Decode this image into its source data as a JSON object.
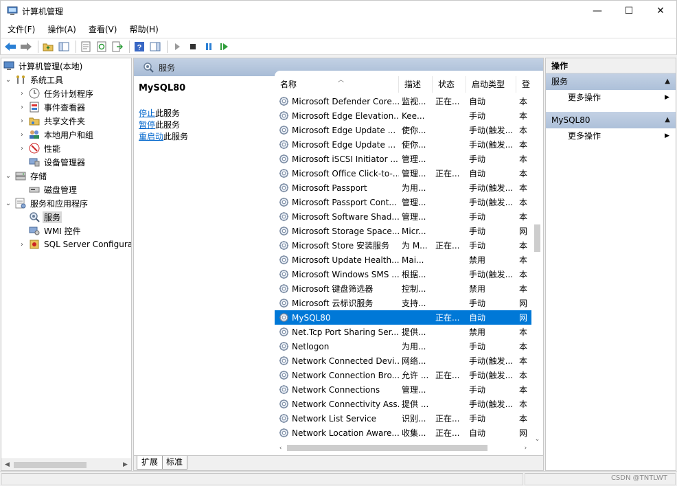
{
  "window": {
    "title": "计算机管理",
    "minimize": "—",
    "maximize": "☐",
    "close": "✕"
  },
  "menu": [
    "文件(F)",
    "操作(A)",
    "查看(V)",
    "帮助(H)"
  ],
  "tree": {
    "root": "计算机管理(本地)",
    "items": [
      {
        "label": "系统工具",
        "level": 1,
        "expanded": true
      },
      {
        "label": "任务计划程序",
        "level": 2
      },
      {
        "label": "事件查看器",
        "level": 2
      },
      {
        "label": "共享文件夹",
        "level": 2
      },
      {
        "label": "本地用户和组",
        "level": 2
      },
      {
        "label": "性能",
        "level": 2
      },
      {
        "label": "设备管理器",
        "level": 2
      },
      {
        "label": "存储",
        "level": 1,
        "expanded": true
      },
      {
        "label": "磁盘管理",
        "level": 2
      },
      {
        "label": "服务和应用程序",
        "level": 1,
        "expanded": true
      },
      {
        "label": "服务",
        "level": 2,
        "selected": true
      },
      {
        "label": "WMI 控件",
        "level": 2
      },
      {
        "label": "SQL Server Configura",
        "level": 2
      }
    ]
  },
  "center": {
    "header": "服务",
    "selected_service": "MySQL80",
    "links": [
      {
        "link": "停止",
        "rest": "此服务"
      },
      {
        "link": "暂停",
        "rest": "此服务"
      },
      {
        "link": "重启动",
        "rest": "此服务"
      }
    ],
    "columns": [
      "名称",
      "描述",
      "状态",
      "启动类型",
      "登"
    ],
    "rows": [
      {
        "name": "Microsoft Defender Core...",
        "desc": "监视...",
        "status": "正在...",
        "startup": "自动",
        "logon": "本"
      },
      {
        "name": "Microsoft Edge Elevation...",
        "desc": "Kee...",
        "status": "",
        "startup": "手动",
        "logon": "本"
      },
      {
        "name": "Microsoft Edge Update ...",
        "desc": "使你...",
        "status": "",
        "startup": "手动(触发...",
        "logon": "本"
      },
      {
        "name": "Microsoft Edge Update ...",
        "desc": "使你...",
        "status": "",
        "startup": "手动(触发...",
        "logon": "本"
      },
      {
        "name": "Microsoft iSCSI Initiator ...",
        "desc": "管理...",
        "status": "",
        "startup": "手动",
        "logon": "本"
      },
      {
        "name": "Microsoft Office Click-to-...",
        "desc": "管理...",
        "status": "正在...",
        "startup": "自动",
        "logon": "本"
      },
      {
        "name": "Microsoft Passport",
        "desc": "为用...",
        "status": "",
        "startup": "手动(触发...",
        "logon": "本"
      },
      {
        "name": "Microsoft Passport Cont...",
        "desc": "管理...",
        "status": "",
        "startup": "手动(触发...",
        "logon": "本"
      },
      {
        "name": "Microsoft Software Shad...",
        "desc": "管理...",
        "status": "",
        "startup": "手动",
        "logon": "本"
      },
      {
        "name": "Microsoft Storage Space...",
        "desc": "Micr...",
        "status": "",
        "startup": "手动",
        "logon": "网"
      },
      {
        "name": "Microsoft Store 安装服务",
        "desc": "为 M...",
        "status": "正在...",
        "startup": "手动",
        "logon": "本"
      },
      {
        "name": "Microsoft Update Health...",
        "desc": "Mai...",
        "status": "",
        "startup": "禁用",
        "logon": "本"
      },
      {
        "name": "Microsoft Windows SMS ...",
        "desc": "根据...",
        "status": "",
        "startup": "手动(触发...",
        "logon": "本"
      },
      {
        "name": "Microsoft 键盘筛选器",
        "desc": "控制...",
        "status": "",
        "startup": "禁用",
        "logon": "本"
      },
      {
        "name": "Microsoft 云标识服务",
        "desc": "支持...",
        "status": "",
        "startup": "手动",
        "logon": "网"
      },
      {
        "name": "MySQL80",
        "desc": "",
        "status": "正在...",
        "startup": "自动",
        "logon": "网",
        "selected": true
      },
      {
        "name": "Net.Tcp Port Sharing Ser...",
        "desc": "提供...",
        "status": "",
        "startup": "禁用",
        "logon": "本"
      },
      {
        "name": "Netlogon",
        "desc": "为用...",
        "status": "",
        "startup": "手动",
        "logon": "本"
      },
      {
        "name": "Network Connected Devi...",
        "desc": "网络...",
        "status": "",
        "startup": "手动(触发...",
        "logon": "本"
      },
      {
        "name": "Network Connection Bro...",
        "desc": "允许 ...",
        "status": "正在...",
        "startup": "手动(触发...",
        "logon": "本"
      },
      {
        "name": "Network Connections",
        "desc": "管理...",
        "status": "",
        "startup": "手动",
        "logon": "本"
      },
      {
        "name": "Network Connectivity Ass...",
        "desc": "提供 ...",
        "status": "",
        "startup": "手动(触发...",
        "logon": "本"
      },
      {
        "name": "Network List Service",
        "desc": "识别...",
        "status": "正在...",
        "startup": "手动",
        "logon": "本"
      },
      {
        "name": "Network Location Aware...",
        "desc": "收集...",
        "status": "正在...",
        "startup": "自动",
        "logon": "网"
      }
    ],
    "tabs": [
      "扩展",
      "标准"
    ]
  },
  "actions": {
    "title": "操作",
    "sections": [
      {
        "label": "服务",
        "item": "更多操作"
      },
      {
        "label": "MySQL80",
        "item": "更多操作"
      }
    ]
  },
  "statusbar": {
    "watermark": "CSDN @TNTLWT"
  },
  "colors": {
    "selection": "#0078d7",
    "link": "#0066cc",
    "header_gradient": "#a8bcd6"
  }
}
